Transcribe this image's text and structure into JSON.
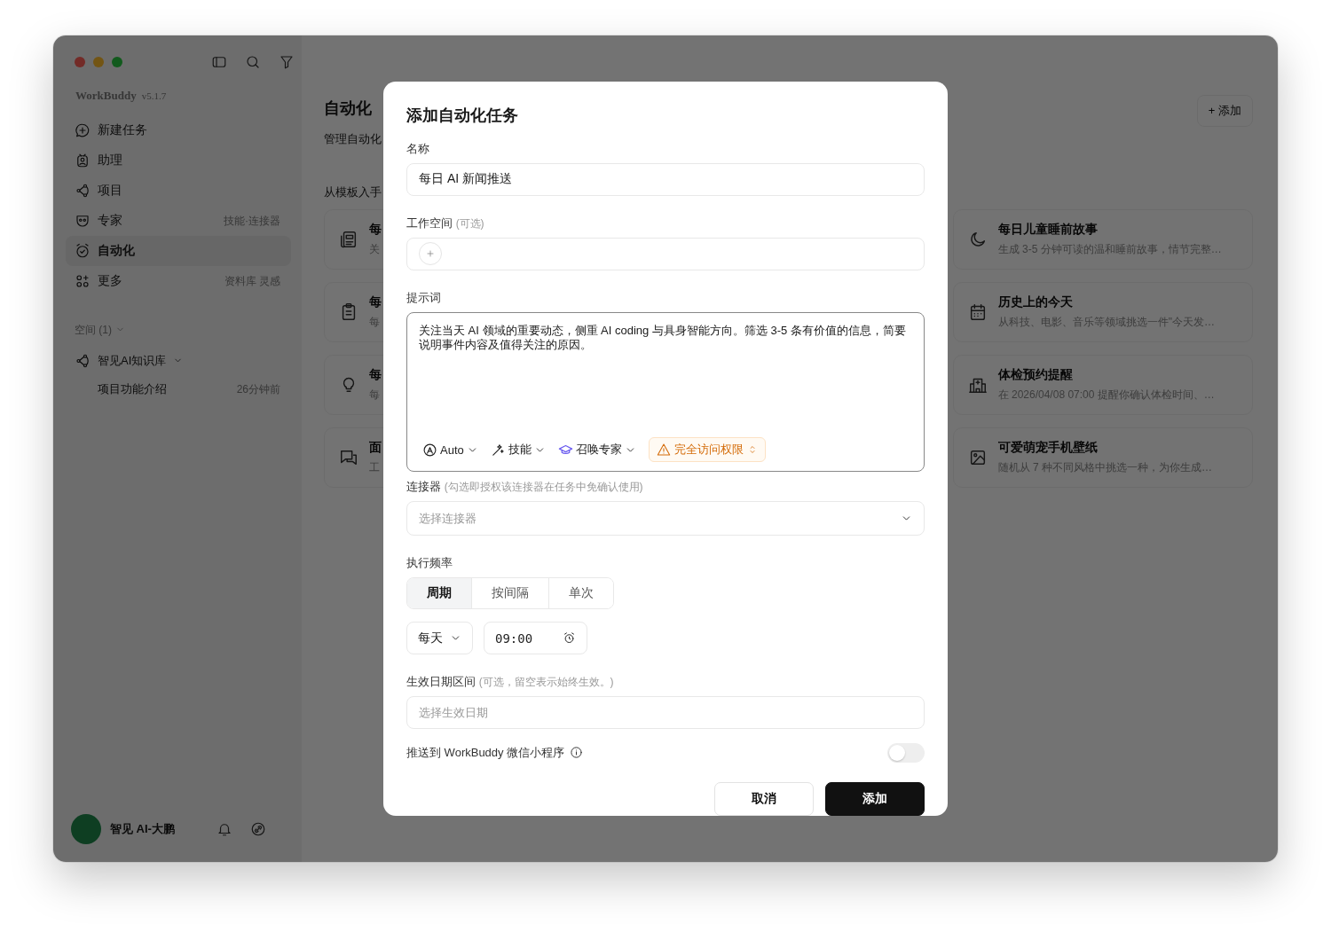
{
  "sidebar": {
    "brand": "WorkBuddy",
    "version": "v5.1.7",
    "nav": [
      {
        "label": "新建任务",
        "selected": false
      },
      {
        "label": "助理",
        "selected": false
      },
      {
        "label": "项目",
        "selected": false
      },
      {
        "label": "专家",
        "hint": "技能·连接器",
        "selected": false
      },
      {
        "label": "自动化",
        "selected": true
      },
      {
        "label": "更多",
        "hint": "资料库 灵感",
        "selected": false
      }
    ],
    "section": {
      "label": "空间 (1)",
      "expanded": true
    },
    "tree": [
      {
        "label": "智见AI知识库",
        "expanded": true,
        "children": [
          {
            "label": "项目功能介绍",
            "time": "26分钟前"
          }
        ]
      }
    ],
    "user": {
      "name": "智见 AI-大鹏"
    }
  },
  "main": {
    "title": "自动化",
    "subtitle": "管理自动化",
    "add_button": "+ 添加",
    "section_label": "从模板入手",
    "templates_left": [
      {
        "title": "每",
        "description": "关"
      },
      {
        "title": "每",
        "description": "每"
      },
      {
        "title": "每",
        "description": "每"
      },
      {
        "title": "面",
        "description": "工"
      }
    ],
    "templates_right": [
      {
        "title": "每日儿童睡前故事",
        "description": "生成 3-5 分钟可读的温和睡前故事，情节完整…"
      },
      {
        "title": "历史上的今天",
        "description": "从科技、电影、音乐等领域挑选一件\"今天发…"
      },
      {
        "title": "体检预约提醒",
        "description": "在 2026/04/08 07:00 提醒你确认体检时间、…"
      },
      {
        "title": "可爱萌宠手机壁纸",
        "description": "随机从 7 种不同风格中挑选一种，为你生成…"
      }
    ]
  },
  "dialog": {
    "title": "添加自动化任务",
    "name": {
      "label": "名称",
      "value": "每日 AI 新闻推送"
    },
    "workspace": {
      "label": "工作空间",
      "hint": "(可选)"
    },
    "prompt": {
      "label": "提示词",
      "value": "关注当天 AI 领域的重要动态，侧重 AI coding 与具身智能方向。筛选 3-5 条有价值的信息，简要说明事件内容及值得关注的原因。",
      "toolbar": [
        {
          "kind": "model",
          "label": "Auto"
        },
        {
          "kind": "skill",
          "label": "技能"
        },
        {
          "kind": "expert",
          "label": "召唤专家"
        },
        {
          "kind": "warning",
          "label": "完全访问权限"
        }
      ]
    },
    "connector": {
      "label": "连接器",
      "hint": "(勾选即授权该连接器在任务中免确认使用)",
      "placeholder": "选择连接器"
    },
    "frequency": {
      "label": "执行频率",
      "tabs": [
        {
          "label": "周期",
          "selected": true
        },
        {
          "label": "按间隔",
          "selected": false
        },
        {
          "label": "单次",
          "selected": false
        }
      ],
      "period": "每天",
      "time": "09:00"
    },
    "date_range": {
      "label": "生效日期区间",
      "hint": "(可选，留空表示始终生效。)",
      "placeholder": "选择生效日期"
    },
    "push": {
      "label": "推送到 WorkBuddy 微信小程序",
      "on": false
    },
    "buttons": [
      {
        "kind": "secondary",
        "label": "取消"
      },
      {
        "kind": "primary",
        "label": "添加"
      }
    ]
  }
}
